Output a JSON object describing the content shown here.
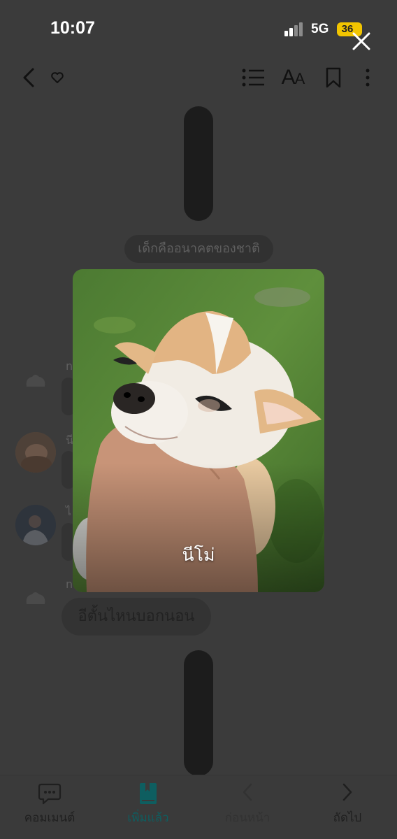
{
  "status_bar": {
    "time": "10:07",
    "network": "5G",
    "battery": "36"
  },
  "toolbar": {
    "font_size_big": "A",
    "font_size_small": "A"
  },
  "chat": {
    "chapter_title": "เด็กคืออนาคตของชาติ",
    "sender_initials": [
      "n",
      "นี",
      "ไ",
      "n"
    ],
    "last_message": "อีตั้นไหนบอกนอน"
  },
  "popup": {
    "caption": "นีโม่"
  },
  "bottom_nav": {
    "comment_label": "คอมเมนต์",
    "added_label": "เพิ่มแล้ว",
    "prev_label": "ก่อนหน้า",
    "next_label": "ถัดไป"
  },
  "colors": {
    "overlay_bg": "#3b3b3b",
    "accent_teal": "#0e5e60",
    "battery_yellow": "#f2c500"
  }
}
